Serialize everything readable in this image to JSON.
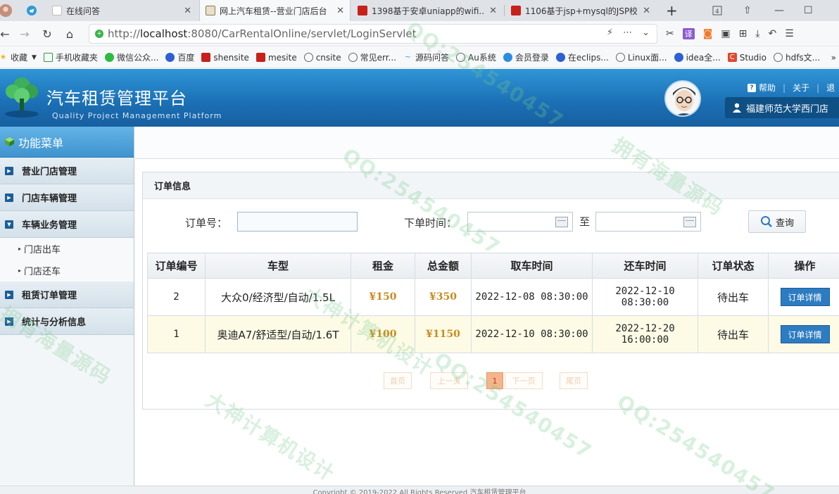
{
  "browser": {
    "tabs": [
      {
        "title": "在线问答",
        "active": false
      },
      {
        "title": "网上汽车租赁--营业门店后台",
        "active": true
      },
      {
        "title": "1398基于安卓uniapp的wifi...",
        "active": false
      },
      {
        "title": "1106基于jsp+mysql的JSP校...",
        "active": false
      }
    ],
    "new_tab": "+",
    "url_prefix": "http://",
    "url_host": "localhost",
    "url_rest": ":8080/CarRentalOnline/servlet/LoginServlet",
    "bookmarks": [
      "收藏",
      "手机收藏夹",
      "微信公众...",
      "百度",
      "shensite",
      "mesite",
      "cnsite",
      "常见err...",
      "源码问答",
      "Au系统",
      "会员登录",
      "在eclips...",
      "Linux面...",
      "idea全...",
      "Studio",
      "hdfs文..."
    ]
  },
  "header": {
    "title": "汽车租赁管理平台",
    "subtitle": "Quality Project Management Platform",
    "links": [
      "帮助",
      "关于",
      "退"
    ],
    "store": "福建师范大学西门店"
  },
  "sidebar": {
    "title": "功能菜单",
    "menu": [
      {
        "label": "营业门店管理"
      },
      {
        "label": "门店车辆管理"
      },
      {
        "label": "车辆业务管理",
        "expanded": true,
        "children": [
          "门店出车",
          "门店还车"
        ]
      },
      {
        "label": "租赁订单管理"
      },
      {
        "label": "统计与分析信息"
      }
    ]
  },
  "panel": {
    "title": "订单信息",
    "search": {
      "order_no_label": "订单号：",
      "order_no_value": "",
      "time_label": "下单时间：",
      "to_label": "至",
      "button": "查询"
    },
    "table": {
      "columns": [
        "订单编号",
        "车型",
        "租金",
        "总金额",
        "取车时间",
        "还车时间",
        "订单状态",
        "操作"
      ],
      "rows": [
        {
          "id": "2",
          "model": "大众0/经济型/自动/1.5L",
          "rent": "¥150",
          "total": "¥350",
          "pickup": "2022-12-08 08:30:00",
          "return_date": "2022-12-10",
          "return_time": "08:30:00",
          "status": "待出车",
          "action": "订单详情"
        },
        {
          "id": "1",
          "model": "奥迪A7/舒适型/自动/1.6T",
          "rent": "¥100",
          "total": "¥1150",
          "pickup": "2022-12-10 08:30:00",
          "return_date": "2022-12-20",
          "return_time": "16:00:00",
          "status": "待出车",
          "action": "订单详情"
        }
      ]
    },
    "pager": {
      "first": "首页",
      "prev": "上一页",
      "current": "1",
      "next": "下一页",
      "last": "尾页"
    }
  },
  "footer": "Copyright © 2019-2022 All Rights Reserved 汽车租赁管理平台",
  "watermarks": [
    "QQ:254540457",
    "大神计算机设计",
    "拥有海量源码"
  ],
  "colors": {
    "header_blue": "#1b6fb4",
    "detail_button": "#2d7cc1",
    "money": "#c98a1c",
    "current_page": "#f6b48c"
  }
}
